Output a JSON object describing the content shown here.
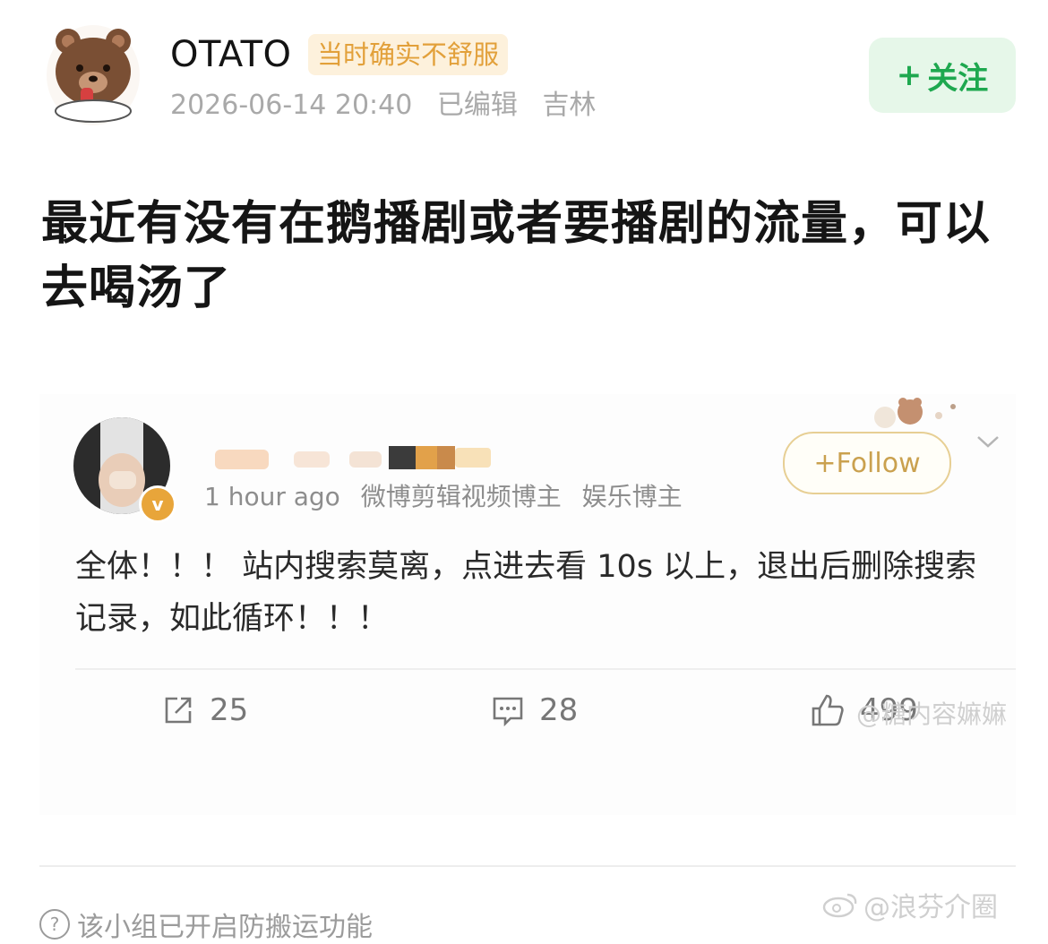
{
  "post": {
    "author": {
      "name": "OTATO",
      "tag": "当时确实不舒服",
      "avatar_icon": "bear-avatar-icon"
    },
    "meta": {
      "datetime": "2026-06-14 20:40",
      "edited": "已编辑",
      "location": "吉林"
    },
    "follow_button": {
      "plus": "+",
      "label": "关注"
    },
    "text": "最近有没有在鹅播剧或者要播剧的流量，可以去喝汤了"
  },
  "embedded": {
    "author_time": "1 hour ago",
    "author_tags": [
      "微博剪辑视频博主",
      "娱乐博主"
    ],
    "follow_label": "+Follow",
    "text": "全体！！！ 站内搜索莫离，点进去看 10s 以上，退出后删除搜索记录，如此循环！！！",
    "actions": {
      "repost_count": "25",
      "comment_count": "28",
      "like_count": "499"
    },
    "watermark": "@糖内容嫲嫲"
  },
  "footer": {
    "notice": "该小组已开启防搬运功能",
    "watermark": "@浪芬介圈"
  },
  "colors": {
    "follow_green": "#1ea84f",
    "tag_orange": "#e2a03a",
    "embedded_follow_gold": "#caa14f"
  }
}
